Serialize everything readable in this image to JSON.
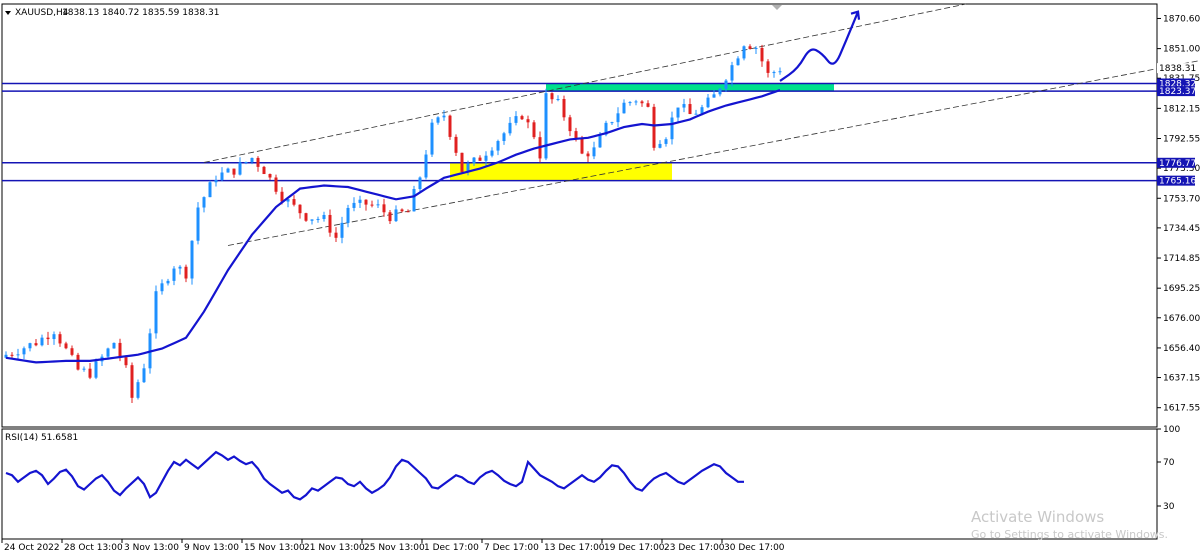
{
  "header": {
    "symbol": "XAUUSD,H4",
    "ohlc": "1838.13 1840.72 1835.59 1838.31"
  },
  "watermark": {
    "title": "Activate Windows",
    "subtitle": "Go to Settings to activate Windows."
  },
  "colors": {
    "bull": "#1e90ff",
    "bear": "#e02020",
    "ma": "#1414d0",
    "hline": "#1414b4",
    "green_zone": "#00e08c",
    "yellow_zone": "#ffff00",
    "rsi": "#1414d0"
  },
  "chart_data": [
    {
      "type": "candlestick",
      "title": "",
      "symbol": "XAUUSD,H4",
      "last_price": 1838.31,
      "ylim": [
        1605,
        1880
      ],
      "y_ticks": [
        1870.6,
        1851.0,
        1831.75,
        1812.15,
        1792.55,
        1773.3,
        1753.7,
        1734.45,
        1714.85,
        1695.25,
        1676.0,
        1656.4,
        1637.15,
        1617.55
      ],
      "x_tick_labels": [
        "24 Oct 2022",
        "28 Oct 13:00",
        "3 Nov 13:00",
        "9 Nov 13:00",
        "15 Nov 13:00",
        "21 Nov 13:00",
        "25 Nov 13:00",
        "1 Dec 17:00",
        "7 Dec 17:00",
        "13 Dec 17:00",
        "19 Dec 17:00",
        "23 Dec 17:00",
        "30 Dec 17:00"
      ],
      "bar_count": 130,
      "close_path_anchors": [
        [
          0,
          1652
        ],
        [
          5,
          1660
        ],
        [
          8,
          1668
        ],
        [
          10,
          1655
        ],
        [
          12,
          1642
        ],
        [
          14,
          1640
        ],
        [
          16,
          1650
        ],
        [
          18,
          1660
        ],
        [
          20,
          1642
        ],
        [
          21,
          1624
        ],
        [
          23,
          1645
        ],
        [
          25,
          1690
        ],
        [
          28,
          1710
        ],
        [
          30,
          1705
        ],
        [
          32,
          1748
        ],
        [
          35,
          1768
        ],
        [
          38,
          1772
        ],
        [
          41,
          1780
        ],
        [
          43,
          1772
        ],
        [
          46,
          1755
        ],
        [
          48,
          1748
        ],
        [
          50,
          1742
        ],
        [
          53,
          1740
        ],
        [
          55,
          1728
        ],
        [
          57,
          1748
        ],
        [
          60,
          1750
        ],
        [
          62,
          1748
        ],
        [
          64,
          1742
        ],
        [
          67,
          1745
        ],
        [
          69,
          1768
        ],
        [
          71,
          1800
        ],
        [
          73,
          1808
        ],
        [
          75,
          1785
        ],
        [
          76,
          1772
        ],
        [
          79,
          1780
        ],
        [
          81,
          1788
        ],
        [
          84,
          1800
        ],
        [
          86,
          1808
        ],
        [
          88,
          1795
        ],
        [
          89,
          1782
        ],
        [
          90,
          1820
        ],
        [
          92,
          1815
        ],
        [
          94,
          1800
        ],
        [
          96,
          1782
        ],
        [
          98,
          1785
        ],
        [
          100,
          1800
        ],
        [
          103,
          1815
        ],
        [
          105,
          1818
        ],
        [
          107,
          1812
        ],
        [
          108,
          1790
        ],
        [
          110,
          1795
        ],
        [
          112,
          1815
        ],
        [
          114,
          1808
        ],
        [
          116,
          1812
        ],
        [
          118,
          1820
        ],
        [
          121,
          1840
        ],
        [
          123,
          1855
        ],
        [
          125,
          1852
        ],
        [
          127,
          1834
        ],
        [
          129,
          1838
        ]
      ],
      "moving_average_anchors": [
        [
          0,
          1650
        ],
        [
          5,
          1647
        ],
        [
          10,
          1648
        ],
        [
          14,
          1648
        ],
        [
          18,
          1650
        ],
        [
          22,
          1652
        ],
        [
          26,
          1656
        ],
        [
          30,
          1663
        ],
        [
          33,
          1680
        ],
        [
          37,
          1707
        ],
        [
          41,
          1730
        ],
        [
          45,
          1748
        ],
        [
          49,
          1760
        ],
        [
          53,
          1762
        ],
        [
          57,
          1761
        ],
        [
          61,
          1757
        ],
        [
          65,
          1753
        ],
        [
          68,
          1755
        ],
        [
          70,
          1760
        ],
        [
          73,
          1767
        ],
        [
          76,
          1770
        ],
        [
          79,
          1773
        ],
        [
          82,
          1777
        ],
        [
          85,
          1782
        ],
        [
          88,
          1786
        ],
        [
          91,
          1789
        ],
        [
          94,
          1792
        ],
        [
          97,
          1793
        ],
        [
          100,
          1796
        ],
        [
          103,
          1800
        ],
        [
          106,
          1802
        ],
        [
          108,
          1801
        ],
        [
          111,
          1802
        ],
        [
          114,
          1805
        ],
        [
          117,
          1810
        ],
        [
          120,
          1814
        ],
        [
          123,
          1817
        ],
        [
          126,
          1820
        ],
        [
          129,
          1824
        ]
      ],
      "horizontal_levels": [
        {
          "value": 1828.32,
          "label": "1828.32"
        },
        {
          "value": 1823.37,
          "label": "1823.37"
        },
        {
          "value": 1776.77,
          "label": "1776.77"
        },
        {
          "value": 1765.16,
          "label": "1765.16"
        }
      ],
      "zones": [
        {
          "color": "green",
          "x_from_bar": 90,
          "x_to_bar": 138,
          "y_from": 1823.5,
          "y_to": 1828.5
        },
        {
          "color": "yellow",
          "x_from_bar": 74,
          "x_to_bar": 111,
          "y_from": 1765.5,
          "y_to": 1776.5
        }
      ],
      "channel_lines": [
        {
          "from": [
            33,
            1777
          ],
          "to": [
            160,
            1880
          ]
        },
        {
          "from": [
            37,
            1723
          ],
          "to": [
            200,
            1844
          ]
        }
      ],
      "projection_path": [
        [
          129,
          1830
        ],
        [
          132,
          1838
        ],
        [
          134,
          1852
        ],
        [
          136,
          1848
        ],
        [
          138,
          1838
        ],
        [
          140,
          1856
        ],
        [
          142,
          1875
        ]
      ]
    },
    {
      "type": "line",
      "title": "RSI(14) 51.6581",
      "label": "RSI(14) 51.6581",
      "y_ticks": [
        100,
        70,
        30
      ],
      "ylim": [
        0,
        100
      ],
      "values": [
        60,
        58,
        52,
        56,
        60,
        62,
        58,
        50,
        55,
        61,
        63,
        57,
        48,
        45,
        50,
        55,
        58,
        52,
        44,
        40,
        46,
        51,
        56,
        50,
        38,
        42,
        52,
        62,
        70,
        67,
        72,
        68,
        64,
        69,
        74,
        79,
        76,
        72,
        75,
        71,
        68,
        70,
        64,
        55,
        50,
        46,
        42,
        44,
        38,
        36,
        40,
        46,
        44,
        48,
        52,
        56,
        55,
        50,
        48,
        52,
        46,
        42,
        45,
        49,
        56,
        66,
        72,
        70,
        65,
        60,
        55,
        47,
        46,
        50,
        54,
        58,
        56,
        52,
        50,
        56,
        60,
        62,
        58,
        53,
        50,
        48,
        52,
        70,
        64,
        58,
        55,
        52,
        48,
        46,
        50,
        54,
        58,
        54,
        52,
        56,
        62,
        67,
        66,
        60,
        52,
        46,
        44,
        50,
        55,
        58,
        60,
        56,
        52,
        50,
        54,
        58,
        62,
        65,
        68,
        66,
        60,
        56,
        52,
        52
      ]
    }
  ]
}
